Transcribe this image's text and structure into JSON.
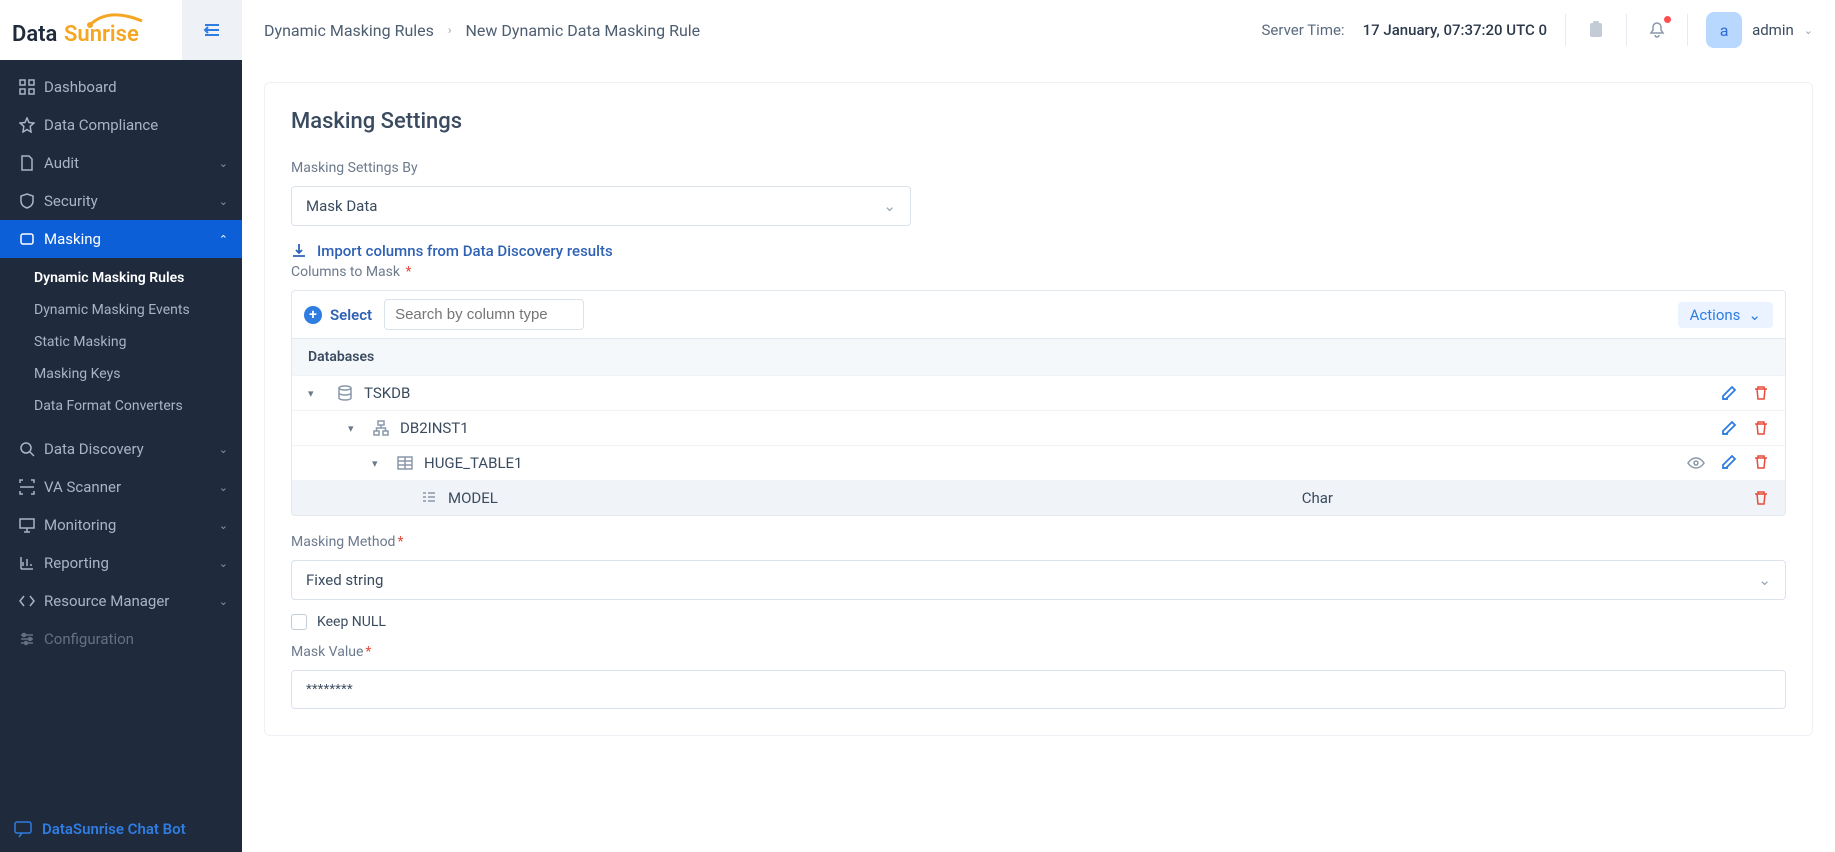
{
  "brand": {
    "part1": "Data",
    "part2": "Sunrise"
  },
  "nav": {
    "dashboard": "Dashboard",
    "compliance": "Data Compliance",
    "audit": "Audit",
    "security": "Security",
    "masking": "Masking",
    "discovery": "Data Discovery",
    "va": "VA Scanner",
    "monitoring": "Monitoring",
    "reporting": "Reporting",
    "resource": "Resource Manager",
    "config": "Configuration",
    "sub": {
      "dmr": "Dynamic Masking Rules",
      "dme": "Dynamic Masking Events",
      "sm": "Static Masking",
      "mk": "Masking Keys",
      "dfc": "Data Format Converters"
    }
  },
  "chatbot": "DataSunrise Chat Bot",
  "breadcrumb": {
    "parent": "Dynamic Masking Rules",
    "current": "New Dynamic Data Masking Rule"
  },
  "header": {
    "server_time_label": "Server Time:",
    "server_time_value": "17 January, 07:37:20  UTC 0",
    "avatar_initial": "a",
    "username": "admin"
  },
  "page": {
    "title": "Masking Settings",
    "settings_by_label": "Masking Settings By",
    "settings_by_value": "Mask Data",
    "import_link": "Import columns from Data Discovery results",
    "columns_label": "Columns to Mask",
    "select_btn": "Select",
    "search_placeholder": "Search by column type",
    "actions": "Actions",
    "tbl_header": "Databases",
    "tree": {
      "db": "TSKDB",
      "schema": "DB2INST1",
      "table": "HUGE_TABLE1",
      "col": "MODEL",
      "col_type": "Char"
    },
    "method_label": "Masking Method",
    "method_value": "Fixed string",
    "keep_null": "Keep NULL",
    "mask_value_label": "Mask Value",
    "mask_value": "********"
  }
}
